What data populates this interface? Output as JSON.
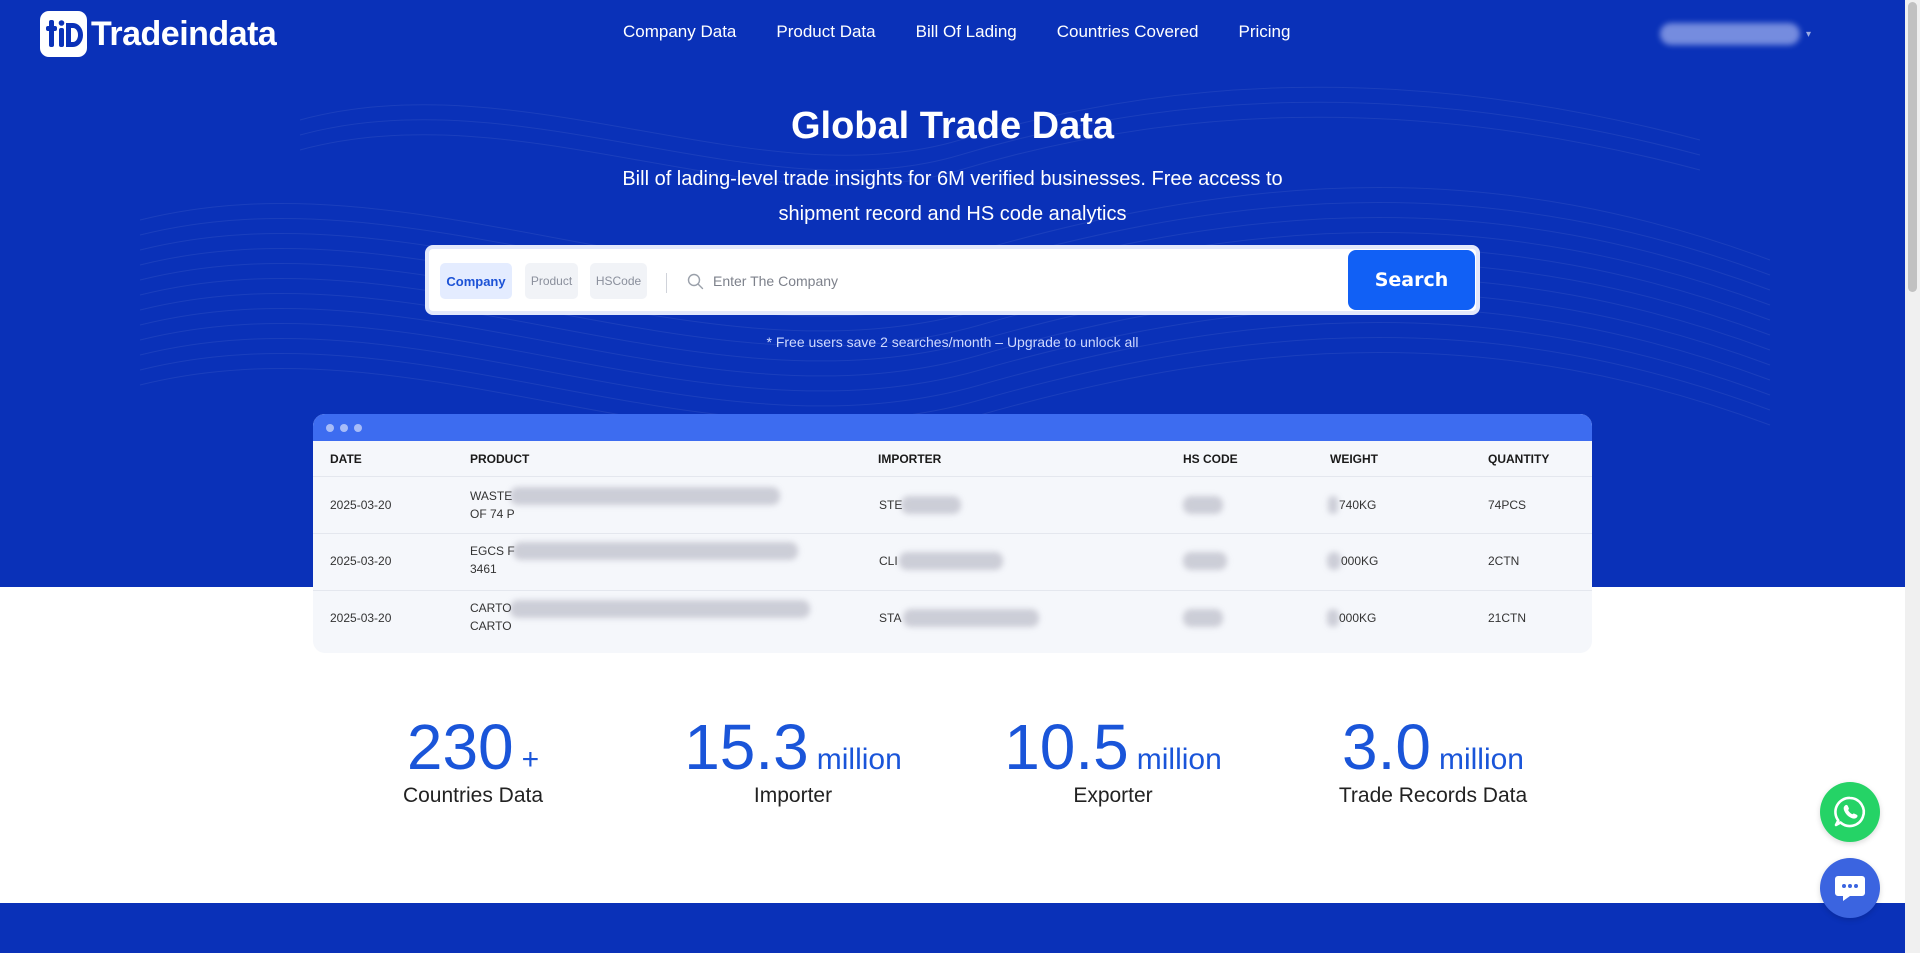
{
  "brand": {
    "name": "Tradeindata",
    "logo_letters": "tiD",
    "accent_color": "#0a31b8",
    "button_color": "#1160f5"
  },
  "nav": {
    "links": [
      {
        "label": "Company Data"
      },
      {
        "label": "Product Data"
      },
      {
        "label": "Bill Of Lading"
      },
      {
        "label": "Countries Covered"
      },
      {
        "label": "Pricing"
      }
    ],
    "user_icon": "blurred-account-name"
  },
  "hero": {
    "title": "Global Trade Data",
    "subtitle": "Bill of lading-level trade insights for 6M verified businesses. Free access to shipment record and HS code analytics"
  },
  "search": {
    "tabs": [
      {
        "label": "Company",
        "active": true
      },
      {
        "label": "Product",
        "active": false
      },
      {
        "label": "HSCode",
        "active": false
      }
    ],
    "placeholder": "Enter The Company",
    "value": "",
    "button_label": "Search",
    "note": "* Free users save 2 searches/month – Upgrade to unlock all"
  },
  "table": {
    "columns": [
      "DATE",
      "PRODUCT",
      "IMPORTER",
      "HS CODE",
      "WEIGHT",
      "QUANTITY"
    ],
    "rows": [
      {
        "date": "2025-03-20",
        "product": "WASTE\nOF 74 P",
        "importer": "STE",
        "hs_code": "",
        "weight": "740KG",
        "quantity": "74PCS"
      },
      {
        "date": "2025-03-20",
        "product": "EGCS F\n3461",
        "importer": "CLI",
        "hs_code": "",
        "weight": "000KG",
        "quantity": "2CTN"
      },
      {
        "date": "2025-03-20",
        "product": "CARTO\nCARTO",
        "importer": "STA",
        "hs_code": "",
        "weight": "000KG",
        "quantity": "21CTN"
      }
    ]
  },
  "stats": [
    {
      "number": "230",
      "unit": "+",
      "label": "Countries Data"
    },
    {
      "number": "15.3",
      "unit": "million",
      "label": "Importer"
    },
    {
      "number": "10.5",
      "unit": "million",
      "label": "Exporter"
    },
    {
      "number": "3.0",
      "unit": "million",
      "label": "Trade Records Data"
    }
  ],
  "floating": {
    "whatsapp_icon": "whatsapp-icon",
    "chat_icon": "chat-bubble-icon"
  }
}
